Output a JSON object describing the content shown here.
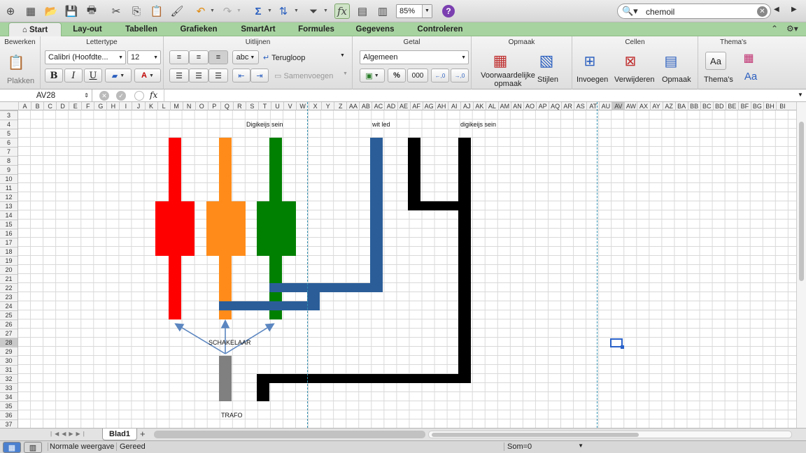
{
  "toolbar": {
    "zoom": "85%",
    "search_value": "chemoil"
  },
  "tabs": [
    "Start",
    "Lay-out",
    "Tabellen",
    "Grafieken",
    "SmartArt",
    "Formules",
    "Gegevens",
    "Controleren"
  ],
  "ribbon": {
    "groups": [
      "Bewerken",
      "Lettertype",
      "Uitlijnen",
      "Getal",
      "Opmaak",
      "Cellen",
      "Thema's"
    ],
    "paste_label": "Plakken",
    "font_name": "Calibri (Hoofdte...",
    "font_size": "12",
    "wrap_label": "Terugloop",
    "merge_label": "Samenvoegen",
    "number_format": "Algemeen",
    "cond_format_label": "Voorwaardelijke opmaak",
    "styles_label": "Stijlen",
    "insert_label": "Invoegen",
    "delete_label": "Verwijderen",
    "format_label": "Opmaak",
    "themes_label": "Thema's",
    "bold": "B",
    "italic": "I",
    "underline": "U",
    "abc": "abc",
    "percent": "%",
    "thousands": "000",
    "fontsample": "Aa"
  },
  "formula_bar": {
    "name_box": "AV28",
    "fx": "fx",
    "formula": ""
  },
  "columns": [
    "A",
    "B",
    "C",
    "D",
    "E",
    "F",
    "G",
    "H",
    "I",
    "J",
    "K",
    "L",
    "M",
    "N",
    "O",
    "P",
    "Q",
    "R",
    "S",
    "T",
    "U",
    "V",
    "W",
    "X",
    "Y",
    "Z",
    "AA",
    "AB",
    "AC",
    "AD",
    "AE",
    "AF",
    "AG",
    "AH",
    "AI",
    "AJ",
    "AK",
    "AL",
    "AM",
    "AN",
    "AO",
    "AP",
    "AQ",
    "AR",
    "AS",
    "AT",
    "AU",
    "AV",
    "AW",
    "AX",
    "AY",
    "AZ",
    "BA",
    "BB",
    "BC",
    "BD",
    "BE",
    "BF",
    "BG",
    "BH",
    "BI"
  ],
  "selected_column": "AV",
  "rows": [
    "3",
    "4",
    "5",
    "6",
    "7",
    "8",
    "9",
    "10",
    "11",
    "12",
    "13",
    "14",
    "15",
    "16",
    "17",
    "18",
    "19",
    "20",
    "21",
    "22",
    "23",
    "24",
    "25",
    "26",
    "27",
    "28",
    "29",
    "30",
    "31",
    "32",
    "33",
    "34",
    "35",
    "36",
    "37"
  ],
  "selected_row": "28",
  "labels": {
    "digikeijs1": "Digikeijs sein",
    "witled": "wit led",
    "digikeijs2": "digikeijs sein",
    "schakelaar": "SCHAKELAAR",
    "trafo": "TRAFO"
  },
  "colors": {
    "red": "#ff0000",
    "orange": "#ff8c1a",
    "green": "#008000",
    "blue": "#2b5e99",
    "black": "#000000",
    "gray": "#808080",
    "tab_green": "#a7d3a0"
  },
  "sheet": {
    "tab": "Blad1",
    "add": "+"
  },
  "status": {
    "view": "Normale weergave",
    "ready": "Gereed",
    "sum": "Som=0"
  }
}
